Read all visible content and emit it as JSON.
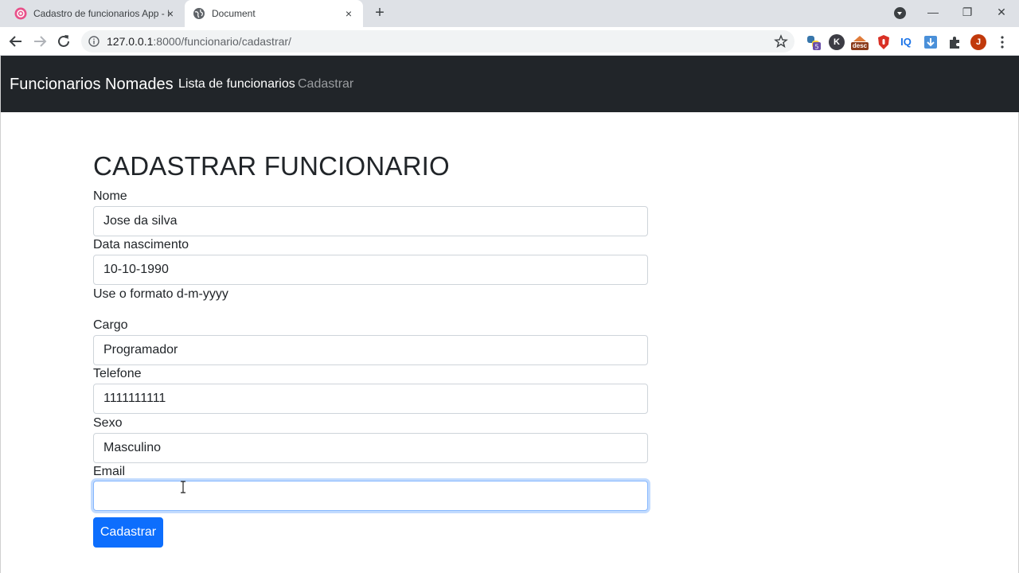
{
  "browser": {
    "tabs": [
      {
        "title": "Cadastro de funcionarios App - I",
        "close": "×"
      },
      {
        "title": "Document",
        "close": "×"
      }
    ],
    "new_tab": "+",
    "window_controls": {
      "minimize": "—",
      "restore": "❐",
      "close": "✕"
    },
    "url_host": "127.0.0.1",
    "url_path": ":8000/funcionario/cadastrar/",
    "extensions": [
      {
        "name": "python-extension-icon",
        "badge": "5"
      },
      {
        "name": "k-extension-icon",
        "letter": "K"
      },
      {
        "name": "desc-extension-icon",
        "letter": "desc"
      },
      {
        "name": "red-shield-extension-icon"
      },
      {
        "name": "iq-extension-icon",
        "letter": "IQ"
      },
      {
        "name": "download-extension-icon"
      },
      {
        "name": "puzzle-extensions-icon"
      },
      {
        "name": "profile-avatar",
        "letter": "J"
      }
    ],
    "colors": {
      "profile": "#c1390b",
      "iq": "#1a73e8",
      "desc": "#8b3a1a"
    }
  },
  "navbar": {
    "brand": "Funcionarios Nomades",
    "links": [
      "Lista de funcionarios",
      "Cadastrar"
    ]
  },
  "form": {
    "title": "CADASTRAR FUNCIONARIO",
    "fields": [
      {
        "label": "Nome",
        "value": "Jose da silva"
      },
      {
        "label": "Data nascimento",
        "value": "10-10-1990",
        "help": "Use o formato d-m-yyyy"
      },
      {
        "label": "Cargo",
        "value": "Programador"
      },
      {
        "label": "Telefone",
        "value": "1111111111"
      },
      {
        "label": "Sexo",
        "value": "Masculino"
      },
      {
        "label": "Email",
        "value": ""
      }
    ],
    "submit": "Cadastrar"
  },
  "colors": {
    "navbar": "#212529",
    "primary": "#0d6efd"
  }
}
